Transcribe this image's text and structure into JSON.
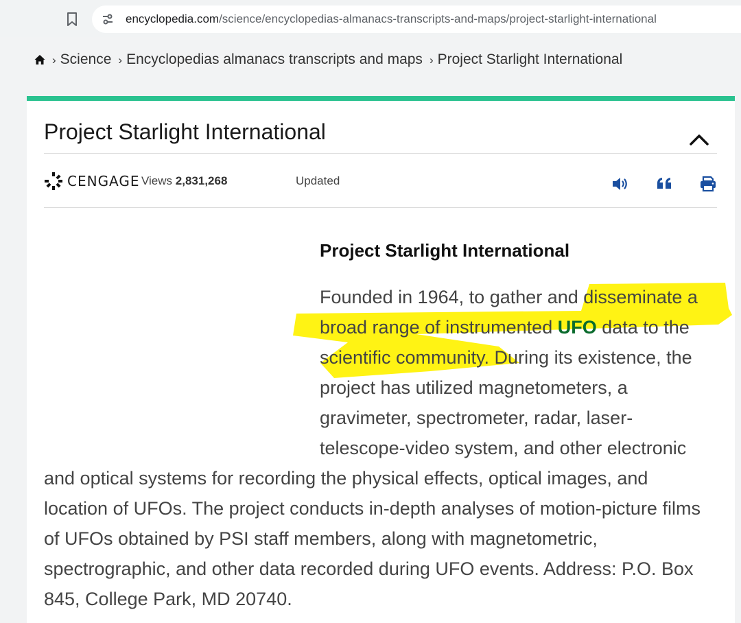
{
  "browser": {
    "url_domain": "encyclopedia.com",
    "url_path": "/science/encyclopedias-almanacs-transcripts-and-maps/project-starlight-international"
  },
  "breadcrumb": {
    "items": [
      "Science",
      "Encyclopedias almanacs transcripts and maps",
      "Project Starlight International"
    ],
    "separator": "›"
  },
  "article": {
    "title": "Project Starlight International",
    "publisher": "CENGAGE",
    "views_label": "Views",
    "views_count": "2,831,268",
    "updated_label": "Updated",
    "heading": "Project Starlight International",
    "lines": {
      "l1a": "Founded in 1964, to gather and disseminate a",
      "l2a": "broad range of instrumented ",
      "l2_link": "UFO",
      "l2b": " data to the",
      "l3": "scientific community. During its existence, the",
      "l4": "project has utilized magnetometers, a",
      "l5": "gravimeter, spectrometer, radar, laser-",
      "l6": "telescope-video system, and other electronic",
      "l7": "and optical systems for recording the physical effects, optical images, and",
      "l8": "location of UFOs. The project conducts in-depth analyses of motion-picture films",
      "l9": "of UFOs obtained by PSI staff members, along with magnetometric,",
      "l10": "spectrographic, and other data recorded during UFO events. Address: P.O. Box",
      "l11": "845, College Park, MD 20740."
    }
  },
  "colors": {
    "accent": "#2ac28f",
    "link": "#0a6b2d",
    "icon_blue": "#1a4fa0",
    "highlight": "#fff200"
  },
  "icons": {
    "bookmark": "bookmark-icon",
    "site_info": "site-info-icon",
    "home": "home-icon",
    "collapse": "chevron-up-icon",
    "listen": "speaker-icon",
    "cite": "quote-icon",
    "print": "printer-icon"
  }
}
